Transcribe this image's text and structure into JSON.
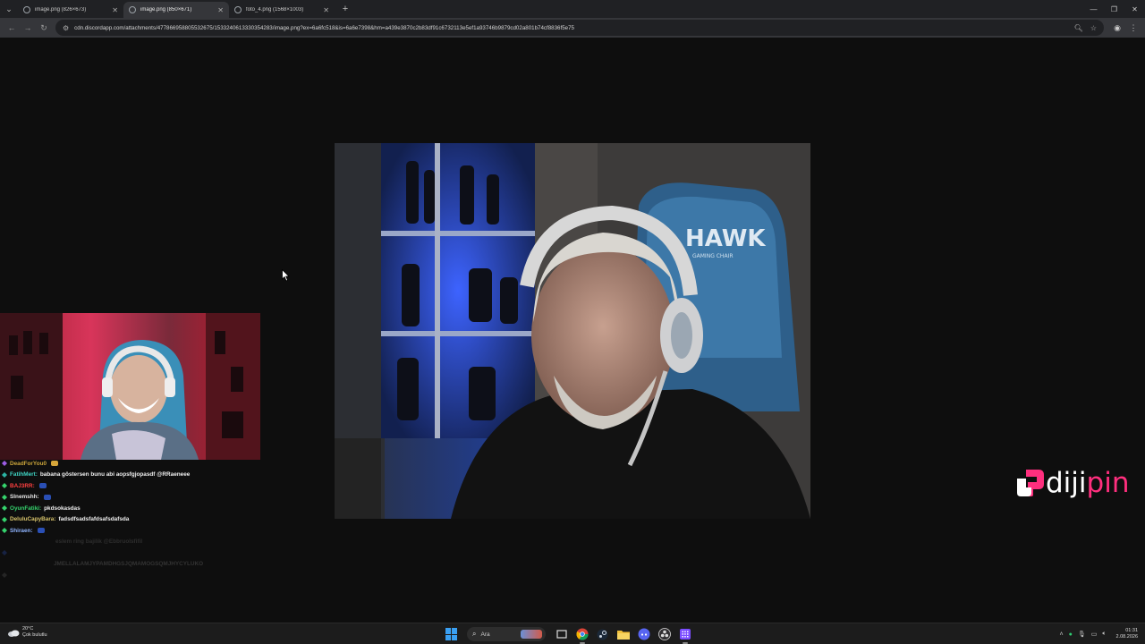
{
  "browser": {
    "tabs": [
      {
        "label": "image.png (826×673)",
        "active": false
      },
      {
        "label": "image.png (850×671)",
        "active": true
      },
      {
        "label": "foto_4.png (1568×1003)",
        "active": false
      }
    ],
    "url": "cdn.discordapp.com/attachments/477866958805532675/1533240613330354283/image.png?ex=6a6fc518&is=6a6e7398&hm=a439e3870c2b83df91c6732113e5ef1a93746b9879cd02a801b74cf8836f5e75"
  },
  "chat": {
    "messages": [
      {
        "user": "DeadForYou0",
        "text": "",
        "color": "#c9a43a",
        "emote": true,
        "faded": false,
        "partial": true
      },
      {
        "user": "FatihMert:",
        "text": "babana göstersen bunu abi aopsfgjopasdf @RRaeneee",
        "color": "#3fd3c3",
        "emote": false,
        "faded": false
      },
      {
        "user": "BAJ3RR:",
        "text": "",
        "color": "#ff4040",
        "emote": true,
        "faded": false
      },
      {
        "user": "Slnemshh:",
        "text": "",
        "color": "#e6e6e6",
        "emote": true,
        "faded": false
      },
      {
        "user": "OyunFatiki:",
        "text": "pkdsokasdas",
        "color": "#35d36d",
        "emote": false,
        "faded": false
      },
      {
        "user": "DeluluCapyBara:",
        "text": "fadsdfsadsfafdsafsdafsda",
        "color": "#d7c36b",
        "emote": false,
        "faded": false
      },
      {
        "user": "Shiraen:",
        "text": "",
        "color": "#8fb4ff",
        "emote": true,
        "faded": false
      },
      {
        "user": "",
        "text": "eslem ring bajilik @Ebbruolsfifil",
        "color": "#777777",
        "emote": false,
        "faded": true
      },
      {
        "user": "",
        "text": "",
        "color": "#3a6cff",
        "emote": false,
        "faded": true
      },
      {
        "user": "",
        "text": "JMELLALAMJYPAMDHGSJQMAMOGSQMJHYCYLUKO",
        "color": "#c23b3b",
        "emote": false,
        "faded": true
      },
      {
        "user": "",
        "text": "",
        "color": "#777777",
        "emote": false,
        "faded": true
      }
    ]
  },
  "watermark": {
    "part1": "diji",
    "part2": "pin"
  },
  "taskbar": {
    "weather_temp": "20°C",
    "weather_desc": "Çok bulutlu",
    "search_label": "Ara",
    "time": "01:31",
    "date": "2.08.2026"
  },
  "colors": {
    "accent_pink": "#ff2f7e",
    "windows_blue": "#3aa0f3"
  }
}
